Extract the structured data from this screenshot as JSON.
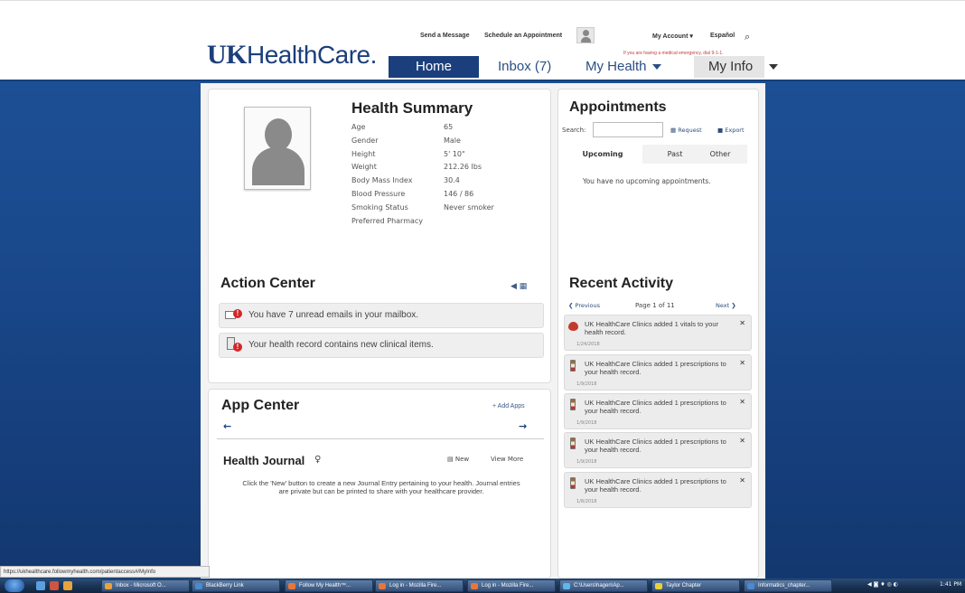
{
  "header": {
    "logo": {
      "uk": "UK",
      "rest": "HealthCare."
    },
    "links": {
      "send_message": "Send a Message",
      "schedule": "Schedule an Appointment",
      "my_account": "My Account",
      "espanol": "Español"
    },
    "emergency_notice": "If you are having a medical emergency, dial 9-1-1.",
    "tabs": {
      "home": "Home",
      "inbox": "Inbox (7)",
      "my_health": "My Health",
      "my_info": "My Info"
    }
  },
  "health_summary": {
    "title": "Health Summary",
    "rows": [
      {
        "label": "Age",
        "value": "65"
      },
      {
        "label": "Gender",
        "value": "Male"
      },
      {
        "label": "Height",
        "value": "5' 10\""
      },
      {
        "label": "Weight",
        "value": "212.26 lbs"
      },
      {
        "label": "Body Mass Index",
        "value": "30.4"
      },
      {
        "label": "Blood Pressure",
        "value": "146 / 86"
      },
      {
        "label": "Smoking Status",
        "value": "Never smoker"
      },
      {
        "label": "Preferred Pharmacy",
        "value": ""
      }
    ]
  },
  "action_center": {
    "title": "Action Center",
    "items": [
      {
        "text": "You have 7 unread emails in your mailbox."
      },
      {
        "text": "Your health record contains new clinical items."
      }
    ]
  },
  "app_center": {
    "title": "App Center",
    "add_apps": "+ Add Apps",
    "journal": {
      "title": "Health Journal",
      "new_label": "New",
      "view_more": "View More",
      "description": "Click the 'New' button to create a new Journal Entry pertaining to your health. Journal entries are private but can be printed to share with your healthcare provider."
    }
  },
  "appointments": {
    "title": "Appointments",
    "search_label": "Search:",
    "search_value": "",
    "request": "Request",
    "export": "Export",
    "tabs": {
      "upcoming": "Upcoming",
      "past": "Past",
      "other": "Other"
    },
    "empty_message": "You have no upcoming appointments."
  },
  "recent_activity": {
    "title": "Recent Activity",
    "previous": "Previous",
    "page": "Page 1 of 11",
    "next": "Next",
    "items": [
      {
        "icon": "heart-icon",
        "text": "UK HealthCare Clinics added 1 vitals to your health record.",
        "date": "1/24/2018"
      },
      {
        "icon": "pill-icon",
        "text": "UK HealthCare Clinics added 1 prescriptions to your health record.",
        "date": "1/9/2018"
      },
      {
        "icon": "pill-icon",
        "text": "UK HealthCare Clinics added 1 prescriptions to your health record.",
        "date": "1/9/2018"
      },
      {
        "icon": "pill-icon",
        "text": "UK HealthCare Clinics added 1 prescriptions to your health record.",
        "date": "1/9/2018"
      },
      {
        "icon": "pill-icon",
        "text": "UK HealthCare Clinics added 1 prescriptions to your health record.",
        "date": "1/8/2018"
      }
    ]
  },
  "statusbar": {
    "url": "https://ukhealthcare.followmyhealth.com/patientaccess#/MyInfo"
  },
  "taskbar": {
    "buttons": [
      "Inbox - Microsoft O...",
      "BlackBerry Link",
      "Follow My Health™...",
      "Log in - Mozilla Fire...",
      "Log in - Mozilla Fire...",
      "C:\\Users\\hagen\\Ap...",
      "Taylor Chapter",
      "Informatics_chapter..."
    ],
    "clock": "1:41 PM"
  },
  "colors": {
    "brand_navy": "#1b3f7c",
    "background_blue": "#1a4a8e",
    "alert_red": "#d42525"
  }
}
